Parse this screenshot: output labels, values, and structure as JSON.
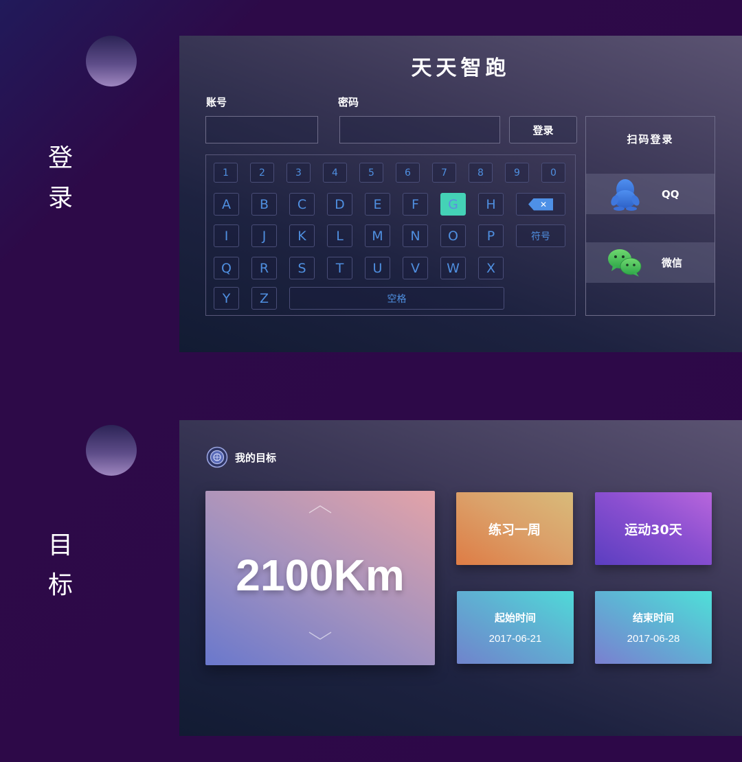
{
  "sections": {
    "login_label": "登录",
    "target_label": "目标"
  },
  "login": {
    "app_title": "天天智跑",
    "account_label": "账号",
    "password_label": "密码",
    "login_button": "登录",
    "keyboard": {
      "numbers": [
        "1",
        "2",
        "3",
        "4",
        "5",
        "6",
        "7",
        "8",
        "9",
        "0"
      ],
      "row1": [
        "A",
        "B",
        "C",
        "D",
        "E",
        "F",
        "G",
        "H"
      ],
      "row2": [
        "I",
        "J",
        "K",
        "L",
        "M",
        "N",
        "O",
        "P"
      ],
      "row3": [
        "Q",
        "R",
        "S",
        "T",
        "U",
        "V",
        "W",
        "X"
      ],
      "row4": [
        "Y",
        "Z"
      ],
      "symbol_key": "符号",
      "space_key": "空格",
      "backspace_glyph": "✕",
      "active_key": "G"
    },
    "scan": {
      "title": "扫码登录",
      "qq_label": "QQ",
      "wechat_label": "微信"
    }
  },
  "target": {
    "header_title": "我的目标",
    "distance": "2100Km",
    "practice_card": "练习一周",
    "exercise_card": "运动30天",
    "start": {
      "label": "起始时间",
      "date": "2017-06-21"
    },
    "end": {
      "label": "结束时间",
      "date": "2017-06-28"
    }
  },
  "colors": {
    "key_text": "#4f8fe0",
    "key_active": "#44d2b6",
    "backspace": "#4e90e6"
  },
  "icons": [
    "qq-penguin-icon",
    "wechat-icon",
    "target-icon",
    "chevron-up-icon",
    "chevron-down-icon",
    "backspace-icon"
  ]
}
